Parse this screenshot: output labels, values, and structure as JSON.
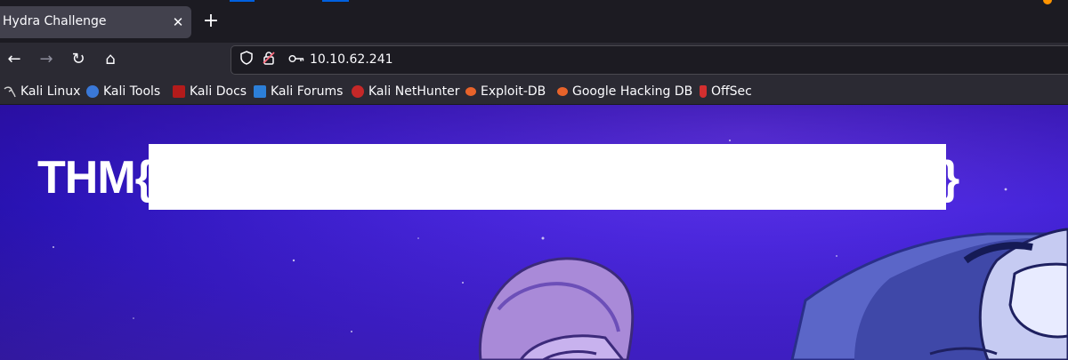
{
  "tab": {
    "title": "Hydra Challenge",
    "close": "✕",
    "new_tab": "+"
  },
  "nav": {
    "back": "←",
    "forward": "→",
    "reload": "↻",
    "home": "⌂"
  },
  "urlbar": {
    "url": "10.10.62.241",
    "icons": [
      "shield-icon",
      "lock-broken-icon",
      "key-icon"
    ]
  },
  "bookmarks": [
    {
      "label": "Kali Linux",
      "icon": "kali-dragon-icon"
    },
    {
      "label": "Kali Tools",
      "icon": "kali-tools-icon"
    },
    {
      "label": "Kali Docs",
      "icon": "kali-docs-icon"
    },
    {
      "label": "Kali Forums",
      "icon": "kali-forums-icon"
    },
    {
      "label": "Kali NetHunter",
      "icon": "kali-nethunter-icon"
    },
    {
      "label": "Exploit-DB",
      "icon": "exploit-db-icon"
    },
    {
      "label": "Google Hacking DB",
      "icon": "ghdb-icon"
    },
    {
      "label": "OffSec",
      "icon": "offsec-icon"
    }
  ],
  "page": {
    "flag_prefix": "THM{",
    "flag_suffix": "}",
    "colors": {
      "background": "#4826dc",
      "redaction": "#ffffff",
      "text": "#ffffff"
    }
  }
}
